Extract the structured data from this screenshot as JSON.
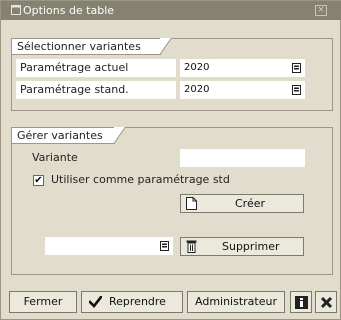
{
  "window": {
    "title": "Options de table"
  },
  "select_group": {
    "title": "Sélectionner variantes",
    "current_label": "Paramétrage actuel",
    "current_value": "2020",
    "standard_label": "Paramétrage stand.",
    "standard_value": "2020"
  },
  "manage_group": {
    "title": "Gérer variantes",
    "variant_label": "Variante",
    "variant_value": "",
    "use_as_std_label": "Utiliser comme paramétrage std",
    "use_as_std_checked": true,
    "create_label": "Créer",
    "delete_value": "",
    "delete_label": "Supprimer"
  },
  "footer": {
    "close_label": "Fermer",
    "apply_label": "Reprendre",
    "admin_label": "Administrateur"
  },
  "icons": {
    "title": "dialog-icon",
    "f4": "value-help-icon",
    "apply": "checkmark-icon",
    "create": "new-document-icon",
    "delete": "trash-icon",
    "info": "info-icon",
    "cancel": "cancel-x-icon"
  }
}
